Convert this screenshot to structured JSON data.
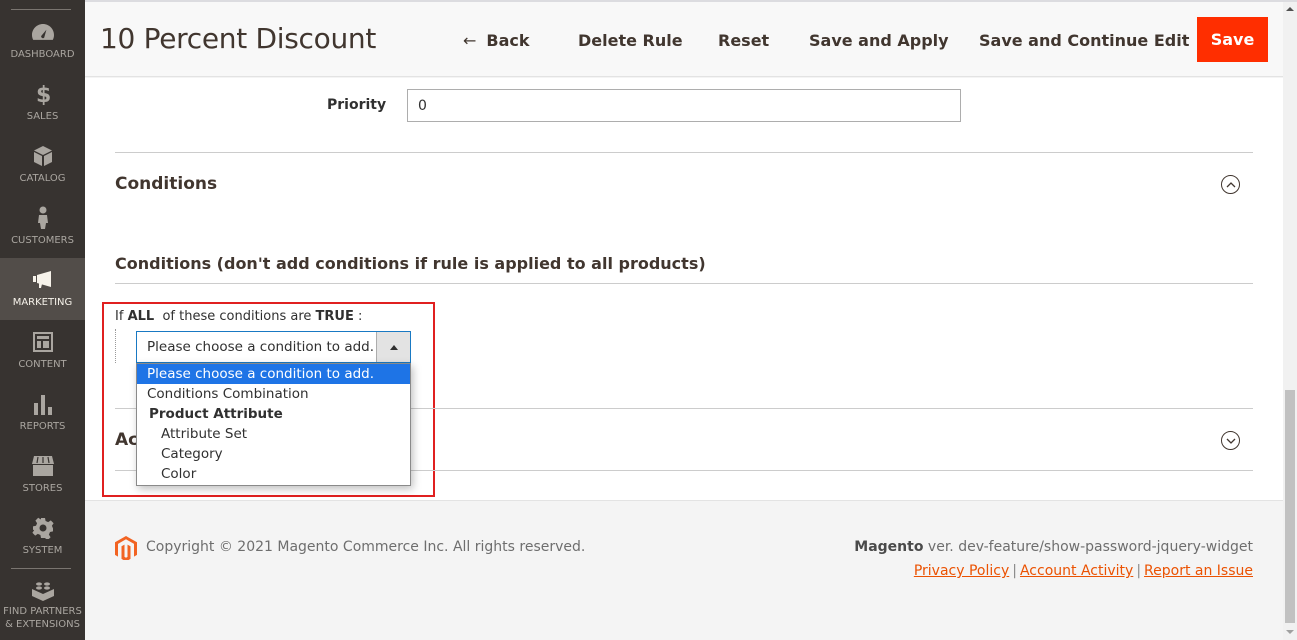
{
  "sidebar": {
    "items": [
      {
        "label": "Dashboard",
        "icon": "dashboard-gauge-icon",
        "active": false
      },
      {
        "label": "Sales",
        "icon": "dollar-icon",
        "active": false
      },
      {
        "label": "Catalog",
        "icon": "box-icon",
        "active": false
      },
      {
        "label": "Customers",
        "icon": "person-icon",
        "active": false
      },
      {
        "label": "Marketing",
        "icon": "megaphone-icon",
        "active": true
      },
      {
        "label": "Content",
        "icon": "layout-icon",
        "active": false
      },
      {
        "label": "Reports",
        "icon": "bar-chart-icon",
        "active": false
      },
      {
        "label": "Stores",
        "icon": "storefront-icon",
        "active": false
      },
      {
        "label": "System",
        "icon": "gear-icon",
        "active": false
      }
    ],
    "partners": {
      "line1": "Find Partners",
      "line2": "& Extensions",
      "icon": "lego-brick-icon"
    }
  },
  "header": {
    "title": "10 Percent Discount",
    "buttons": {
      "back": "Back",
      "back_icon": "←",
      "delete": "Delete Rule",
      "reset": "Reset",
      "save_apply": "Save and Apply",
      "save_continue": "Save and Continue Edit",
      "save": "Save"
    }
  },
  "form": {
    "priority_label": "Priority",
    "priority_value": "0",
    "conditions_section": "Conditions",
    "conditions_subtitle": "Conditions (don't add conditions if rule is applied to all products)",
    "condition_prefix": "If",
    "condition_aggregator": "ALL",
    "condition_middle": "of these conditions are",
    "condition_value": "TRUE",
    "condition_suffix": ":",
    "select_value": "Please choose a condition to add.",
    "dropdown_options": [
      {
        "label": "Please choose a condition to add.",
        "type": "selected"
      },
      {
        "label": "Conditions Combination",
        "type": "option"
      },
      {
        "label": "Product Attribute",
        "type": "group"
      },
      {
        "label": "Attribute Set",
        "type": "child"
      },
      {
        "label": "Category",
        "type": "child"
      },
      {
        "label": "Color",
        "type": "child"
      }
    ],
    "actions_section": "Ac"
  },
  "footer": {
    "copyright": "Copyright © 2021 Magento Commerce Inc. All rights reserved.",
    "brand": "Magento",
    "version": "ver. dev-feature/show-password-jquery-widget",
    "links": [
      "Privacy Policy",
      "Account Activity",
      "Report an Issue"
    ]
  },
  "colors": {
    "sidebar_bg": "#373330",
    "sidebar_active": "#524d49",
    "save_button": "#ff2e00",
    "link": "#eb5202",
    "highlight_border": "#e02020",
    "select_highlight": "#1e74e6"
  }
}
